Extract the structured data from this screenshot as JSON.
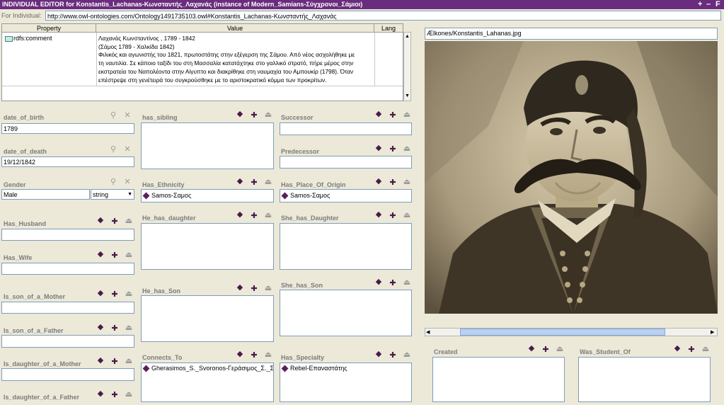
{
  "window": {
    "title": "INDIVIDUAL EDITOR for Konstantis_Lachanas-Κωνσταντής_Λαχανάς   (instance of Modern_Samians-Σύγχρονοι_Σάμιοι)",
    "controls": [
      "+",
      "–",
      "F"
    ]
  },
  "individual": {
    "label": "For Individual:",
    "value": "http://www.owl-ontologies.com/Ontology1491735103.owl#Konstantis_Lachanas-Κωνσταντής_Λαχανάς"
  },
  "property_table": {
    "headers": {
      "property": "Property",
      "value": "Value",
      "lang": "Lang"
    },
    "rows": [
      {
        "property": "rdfs:comment",
        "value_lines": [
          "Λαχανάς Κωνσταντίνος ,  1789 - 1842",
          "(Σάμος 1789 - Χαλκίδα 1842)",
          "   Φιλικός και αγωνιστής του 1821, πρωτοστάτης στην εξέγερση της Σάμου. Από νέος ασχολήθηκε με",
          "τη ναυτιλία. Σε κάποιο ταξίδι του στη Μασσαλία κατατάχτηκε στο γαλλικό στρατό, πήρε μέρος στην",
          "εκστρατεία του Ναπολέοντα στην Αίγυπτο και διακρίθηκε στη ναυμαχία του Αμπουκίρ (1798). Όταν",
          "επέστρεψε στη γενέτειρά του συγκρούσθηκε με το αριστοκρατικό κόμμα των προκρίτων."
        ],
        "lang": ""
      }
    ]
  },
  "fields": {
    "date_of_birth": {
      "label": "date_of_birth",
      "value": "1789"
    },
    "date_of_death": {
      "label": "date_of_death",
      "value": "19/12/1842"
    },
    "gender": {
      "label": "Gender",
      "value": "Male",
      "type": "string"
    },
    "has_husband": {
      "label": "Has_Husband",
      "value": ""
    },
    "has_wife": {
      "label": "Has_Wife",
      "value": ""
    },
    "is_son_of_a_mother": {
      "label": "Is_son_of_a_Mother",
      "value": ""
    },
    "is_son_of_a_father": {
      "label": "Is_son_of_a_Father",
      "value": ""
    },
    "is_daughter_of_a_mother": {
      "label": "Is_daughter_of_a_Mother",
      "value": ""
    },
    "is_daughter_of_a_father": {
      "label": "Is_daughter_of_a_Father",
      "value": ""
    },
    "has_sibling": {
      "label": "has_sibling"
    },
    "has_ethnicity": {
      "label": "Has_Ethnicity",
      "value": "Samos-Σαμος"
    },
    "he_has_daughter": {
      "label": "He_has_daughter"
    },
    "he_has_son": {
      "label": "He_has_Son"
    },
    "connects_to": {
      "label": "Connects_To",
      "value": "Gherasimos_S._Svoronos-Γεράσιμος_Σ._Σβο"
    },
    "successor": {
      "label": "Successor",
      "value": ""
    },
    "predecessor": {
      "label": "Predecessor",
      "value": ""
    },
    "has_place_of_origin": {
      "label": "Has_Place_Of_Origin",
      "value": "Samos-Σαμος"
    },
    "she_has_daughter": {
      "label": "She_has_Daughter"
    },
    "she_has_son": {
      "label": "She_has_Son"
    },
    "has_specialty": {
      "label": "Has_Specialty",
      "value": "Rebel-Επαναστάτης"
    },
    "created": {
      "label": "Created"
    },
    "was_student_of": {
      "label": "Was_Student_Of"
    }
  },
  "image_panel": {
    "file": "Ælkones/Konstantis_Lahanas.jpg"
  },
  "colors": {
    "titlebar": "#6a2c7e",
    "background": "#ece9d8",
    "field_border": "#7f9db9",
    "label_gray": "#7c7c7c",
    "instance_icon": "#5a1f5a"
  }
}
